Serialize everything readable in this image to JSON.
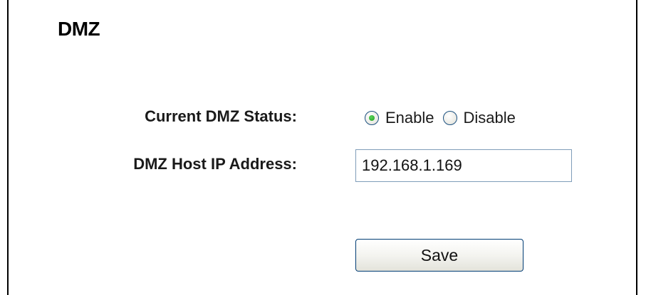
{
  "page": {
    "title": "DMZ"
  },
  "status": {
    "label": "Current DMZ Status:",
    "options": [
      {
        "label": "Enable",
        "selected": true
      },
      {
        "label": "Disable",
        "selected": false
      }
    ]
  },
  "host_ip": {
    "label": "DMZ Host IP Address:",
    "value": "192.168.1.169"
  },
  "actions": {
    "save_label": "Save"
  },
  "colors": {
    "radio_selected_dot": "#21a121",
    "input_border": "#7f9db9",
    "button_border": "#003c74"
  }
}
